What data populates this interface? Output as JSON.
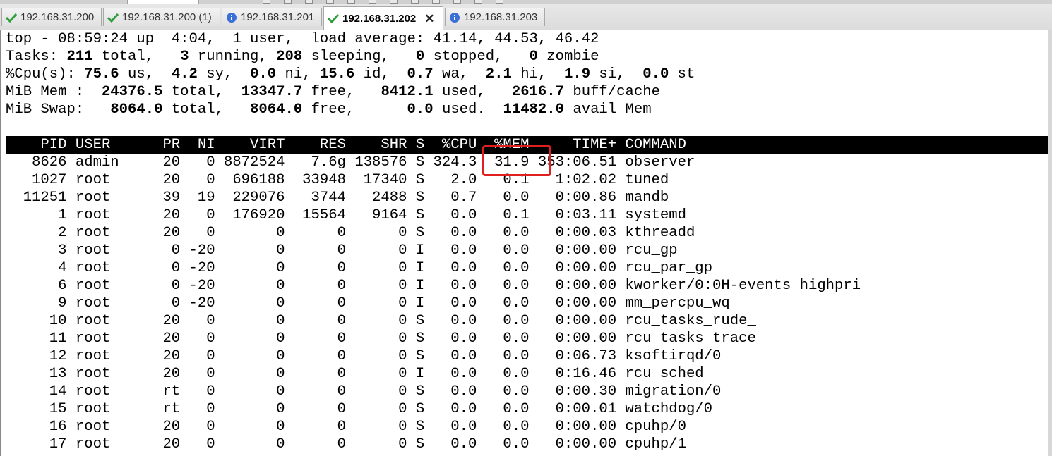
{
  "tabs": [
    {
      "label": "192.168.31.200",
      "icon": "check-icon",
      "active": false
    },
    {
      "label": "192.168.31.200 (1)",
      "icon": "check-icon",
      "active": false
    },
    {
      "label": "192.168.31.201",
      "icon": "info-icon",
      "active": false
    },
    {
      "label": "192.168.31.202",
      "icon": "check-icon",
      "active": true
    },
    {
      "label": "192.168.31.203",
      "icon": "info-icon",
      "active": false
    }
  ],
  "colors": {
    "check": "#2e9e3a",
    "info": "#3a6fd8",
    "highlight": "#e02020"
  },
  "summary": {
    "l1": "top - 08:59:24 up  4:04,  1 user,  load average: 41.14, 44.53, 46.42",
    "l2": {
      "prefix": "Tasks: ",
      "total": "211",
      "t1": " total,   ",
      "running": "3",
      "t2": " running, ",
      "sleeping": "208",
      "t3": " sleeping,   ",
      "stopped": "0",
      "t4": " stopped,   ",
      "zombie": "0",
      "t5": " zombie"
    },
    "l3": {
      "prefix": "%Cpu(s): ",
      "us": "75.6",
      "t1": " us,  ",
      "sy": "4.2",
      "t2": " sy,  ",
      "ni": "0.0",
      "t3": " ni, ",
      "id": "15.6",
      "t4": " id,  ",
      "wa": "0.7",
      "t5": " wa,  ",
      "hi": "2.1",
      "t6": " hi,  ",
      "si": "1.9",
      "t7": " si,  ",
      "st": "0.0",
      "t8": " st"
    },
    "l4": {
      "prefix": "MiB Mem :  ",
      "total": "24376.5",
      "t1": " total,  ",
      "free": "13347.7",
      "t2": " free,   ",
      "used": "8412.1",
      "t3": " used,   ",
      "buff": "2616.7",
      "t4": " buff/cache"
    },
    "l5": {
      "prefix": "MiB Swap:   ",
      "total": "8064.0",
      "t1": " total,   ",
      "free": "8064.0",
      "t2": " free,      ",
      "used": "0.0",
      "t3": " used.  ",
      "avail": "11482.0",
      "t4": " avail Mem"
    }
  },
  "columns": "    PID USER      PR  NI    VIRT    RES    SHR S  %CPU  %MEM     TIME+ COMMAND",
  "processes": [
    "   8626 admin     20   0 8872524   7.6g 138576 S 324.3  31.9 353:06.51 observer",
    "   1027 root      20   0  696188  33948  17340 S   2.0   0.1   1:02.02 tuned",
    "  11251 root      39  19  229076   3744   2488 S   0.7   0.0   0:00.86 mandb",
    "      1 root      20   0  176920  15564   9164 S   0.0   0.1   0:03.11 systemd",
    "      2 root      20   0       0      0      0 S   0.0   0.0   0:00.03 kthreadd",
    "      3 root       0 -20       0      0      0 I   0.0   0.0   0:00.00 rcu_gp",
    "      4 root       0 -20       0      0      0 I   0.0   0.0   0:00.00 rcu_par_gp",
    "      6 root       0 -20       0      0      0 I   0.0   0.0   0:00.00 kworker/0:0H-events_highpri",
    "      9 root       0 -20       0      0      0 I   0.0   0.0   0:00.00 mm_percpu_wq",
    "     10 root      20   0       0      0      0 S   0.0   0.0   0:00.00 rcu_tasks_rude_",
    "     11 root      20   0       0      0      0 S   0.0   0.0   0:00.00 rcu_tasks_trace",
    "     12 root      20   0       0      0      0 S   0.0   0.0   0:06.73 ksoftirqd/0",
    "     13 root      20   0       0      0      0 I   0.0   0.0   0:16.46 rcu_sched",
    "     14 root      rt   0       0      0      0 S   0.0   0.0   0:00.30 migration/0",
    "     15 root      rt   0       0      0      0 S   0.0   0.0   0:00.01 watchdog/0",
    "     16 root      20   0       0      0      0 S   0.0   0.0   0:00.00 cpuhp/0",
    "     17 root      20   0       0      0      0 S   0.0   0.0   0:00.00 cpuhp/1"
  ]
}
